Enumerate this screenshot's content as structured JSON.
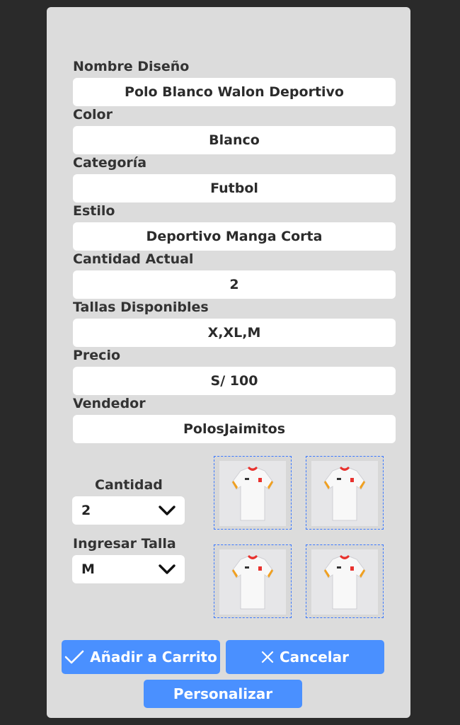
{
  "form": {
    "fields": [
      {
        "label": "Nombre Diseño",
        "value": "Polo Blanco Walon Deportivo"
      },
      {
        "label": "Color",
        "value": "Blanco"
      },
      {
        "label": "Categoría",
        "value": "Futbol"
      },
      {
        "label": "Estilo",
        "value": "Deportivo Manga Corta"
      },
      {
        "label": "Cantidad Actual",
        "value": "2"
      },
      {
        "label": "Tallas Disponibles",
        "value": "X,XL,M"
      },
      {
        "label": "Precio",
        "value": "S/ 100"
      },
      {
        "label": "Vendedor",
        "value": "PolosJaimitos"
      }
    ]
  },
  "order": {
    "quantity_label": "Cantidad",
    "quantity_value": "2",
    "size_label": "Ingresar Talla",
    "size_value": "M"
  },
  "thumbnails": [
    {
      "icon": "jersey-image"
    },
    {
      "icon": "jersey-image"
    },
    {
      "icon": "jersey-image"
    },
    {
      "icon": "jersey-image"
    }
  ],
  "actions": {
    "add_to_cart": "Añadir a Carrito",
    "cancel": "Cancelar",
    "customize": "Personalizar"
  },
  "colors": {
    "accent": "#4a90ff",
    "panel": "#dcdcdc",
    "background": "#2a2a2a"
  }
}
